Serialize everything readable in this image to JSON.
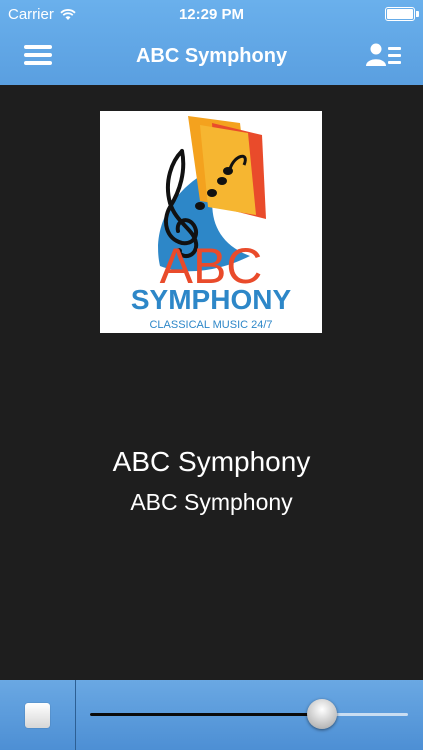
{
  "status_bar": {
    "carrier": "Carrier",
    "time": "12:29 PM"
  },
  "nav": {
    "title": "ABC Symphony"
  },
  "artwork": {
    "logo_text_line1": "ABC",
    "logo_text_line2": "SYMPHONY",
    "logo_text_line3": "CLASSICAL MUSIC 24/7"
  },
  "now_playing": {
    "station": "ABC Symphony",
    "subtitle": "ABC Symphony"
  },
  "player": {
    "volume_level": 0.73
  },
  "colors": {
    "nav_blue": "#5a9fe0",
    "background": "#1e1e1e",
    "logo_red": "#e94b2b",
    "logo_blue": "#2d87c8",
    "logo_orange": "#f4a21e"
  }
}
